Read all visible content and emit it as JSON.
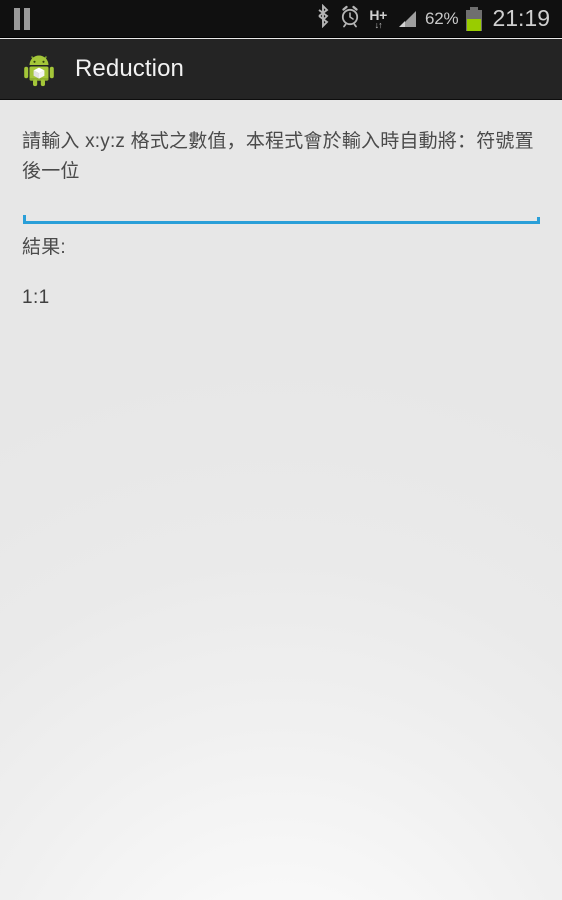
{
  "status_bar": {
    "media_icon": "pause-icon",
    "bluetooth_icon": "bluetooth-icon",
    "alarm_icon": "alarm-clock-icon",
    "network_type": "H+",
    "network_arrows": "↓↑",
    "signal_icon": "signal-bars-icon",
    "battery_percent": "62%",
    "battery_icon": "battery-icon",
    "battery_level": 62,
    "battery_color": "#99cc00",
    "time": "21:19"
  },
  "action_bar": {
    "app_icon": "android-robot-icon",
    "title": "Reduction"
  },
  "content": {
    "hint": "請輸入 x:y:z 格式之數值，本程式會於輸入時自動將：符號置後一位",
    "input_value": "",
    "input_placeholder": "",
    "input_accent_color": "#2a9fd8",
    "result_label": "結果:",
    "result_value": "1:1"
  }
}
